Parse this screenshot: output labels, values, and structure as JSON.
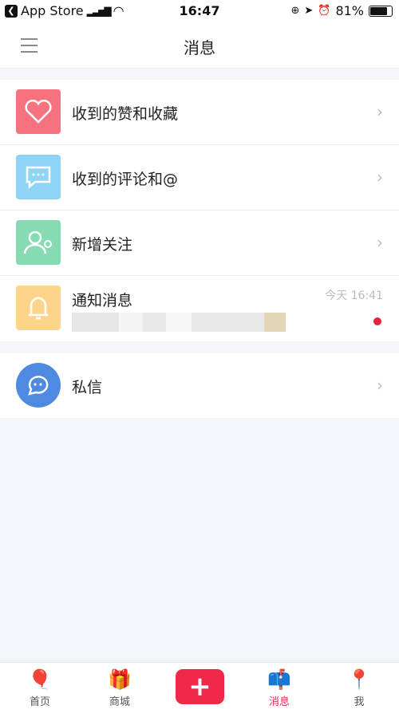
{
  "status_bar": {
    "back_app": "App Store",
    "time": "16:47",
    "battery": "81%",
    "battery_level": 0.81
  },
  "header": {
    "title": "消息",
    "menu_icon": "hamburger-icon"
  },
  "items": [
    {
      "label": "收到的赞和收藏",
      "icon": "heart-icon",
      "color": "#f7727f"
    },
    {
      "label": "收到的评论和@",
      "icon": "comment-icon",
      "color": "#8fd3f7"
    },
    {
      "label": "新增关注",
      "icon": "user-add-icon",
      "color": "#86dbb2"
    },
    {
      "label": "通知消息",
      "icon": "bell-icon",
      "color": "#fdd58a",
      "time": "今天 16:41",
      "unread": true
    }
  ],
  "private": {
    "label": "私信",
    "icon": "chat-icon",
    "color": "#4d8ae0"
  },
  "tabbar": {
    "accent": "#f0284a",
    "tabs": [
      {
        "label": "首页"
      },
      {
        "label": "商城"
      },
      {
        "label": "+"
      },
      {
        "label": "消息",
        "active": true
      },
      {
        "label": "我"
      }
    ]
  }
}
